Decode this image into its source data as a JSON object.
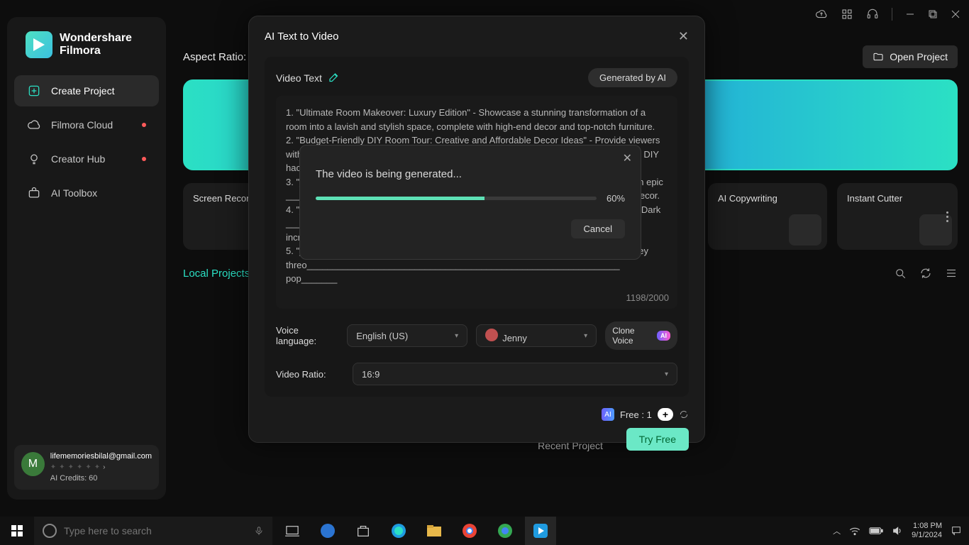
{
  "titlebar": {
    "icons": [
      "cloud",
      "grid",
      "headset"
    ],
    "window_controls": [
      "minimize",
      "maximize",
      "close"
    ]
  },
  "logo": {
    "line1": "Wondershare",
    "line2": "Filmora"
  },
  "sidebar": {
    "items": [
      {
        "label": "Create Project",
        "icon": "plus-square-icon",
        "active": true,
        "dot": false
      },
      {
        "label": "Filmora Cloud",
        "icon": "cloud-icon",
        "active": false,
        "dot": true
      },
      {
        "label": "Creator Hub",
        "icon": "bulb-icon",
        "active": false,
        "dot": true
      },
      {
        "label": "AI Toolbox",
        "icon": "ai-toolbox-icon",
        "active": false,
        "dot": false
      }
    ]
  },
  "account": {
    "avatar_letter": "M",
    "email": "lifememoriesbilal@gmail.com",
    "credits": "AI Credits: 60"
  },
  "main": {
    "aspect_label": "Aspect Ratio:",
    "open_project": "Open Project",
    "tiles": [
      {
        "label": "Screen Recorder"
      },
      {
        "label": "AI Copywriting"
      },
      {
        "label": "Instant Cutter"
      }
    ],
    "local_projects": "Local Projects",
    "recent": "Recent Project"
  },
  "dialog": {
    "title": "AI Text to Video",
    "video_text_label": "Video Text",
    "generated_by_ai": "Generated by AI",
    "text": "1. \"Ultimate Room Makeover: Luxury Edition\" - Showcase a stunning transformation of a room into a lavish and stylish space, complete with high-end decor and top-notch furniture.\n2. \"Budget-Friendly DIY Room Tour: Creative and Affordable Decor Ideas\" - Provide viewers with innovative ways to revamp their rooms on a tight budget, sharing simple yet trendy DIY hacks and cost-effective decor options.\n3. \"________________________________________________________________\" an epic _____________________________________________________________ themed decor.\n4. \"________________________________________________________________\" a Dark _____________________________________________________________\nincre_______\n5. \"________________________________________________________________\" ney threo_____________________________________________________________\npop_______",
    "char_count": "1198/2000",
    "voice_language_label": "Voice language:",
    "voice_language_value": "English (US)",
    "voice_name": "Jenny",
    "clone_voice": "Clone Voice",
    "ratio_label": "Video Ratio:",
    "ratio_value": "16:9",
    "free_label": "Free : 1",
    "try_free": "Try Free"
  },
  "progress": {
    "text": "The video is being generated...",
    "percent": 60,
    "percent_label": "60%",
    "cancel": "Cancel"
  },
  "taskbar": {
    "search_placeholder": "Type here to search",
    "time": "1:08 PM",
    "date": "9/1/2024"
  }
}
